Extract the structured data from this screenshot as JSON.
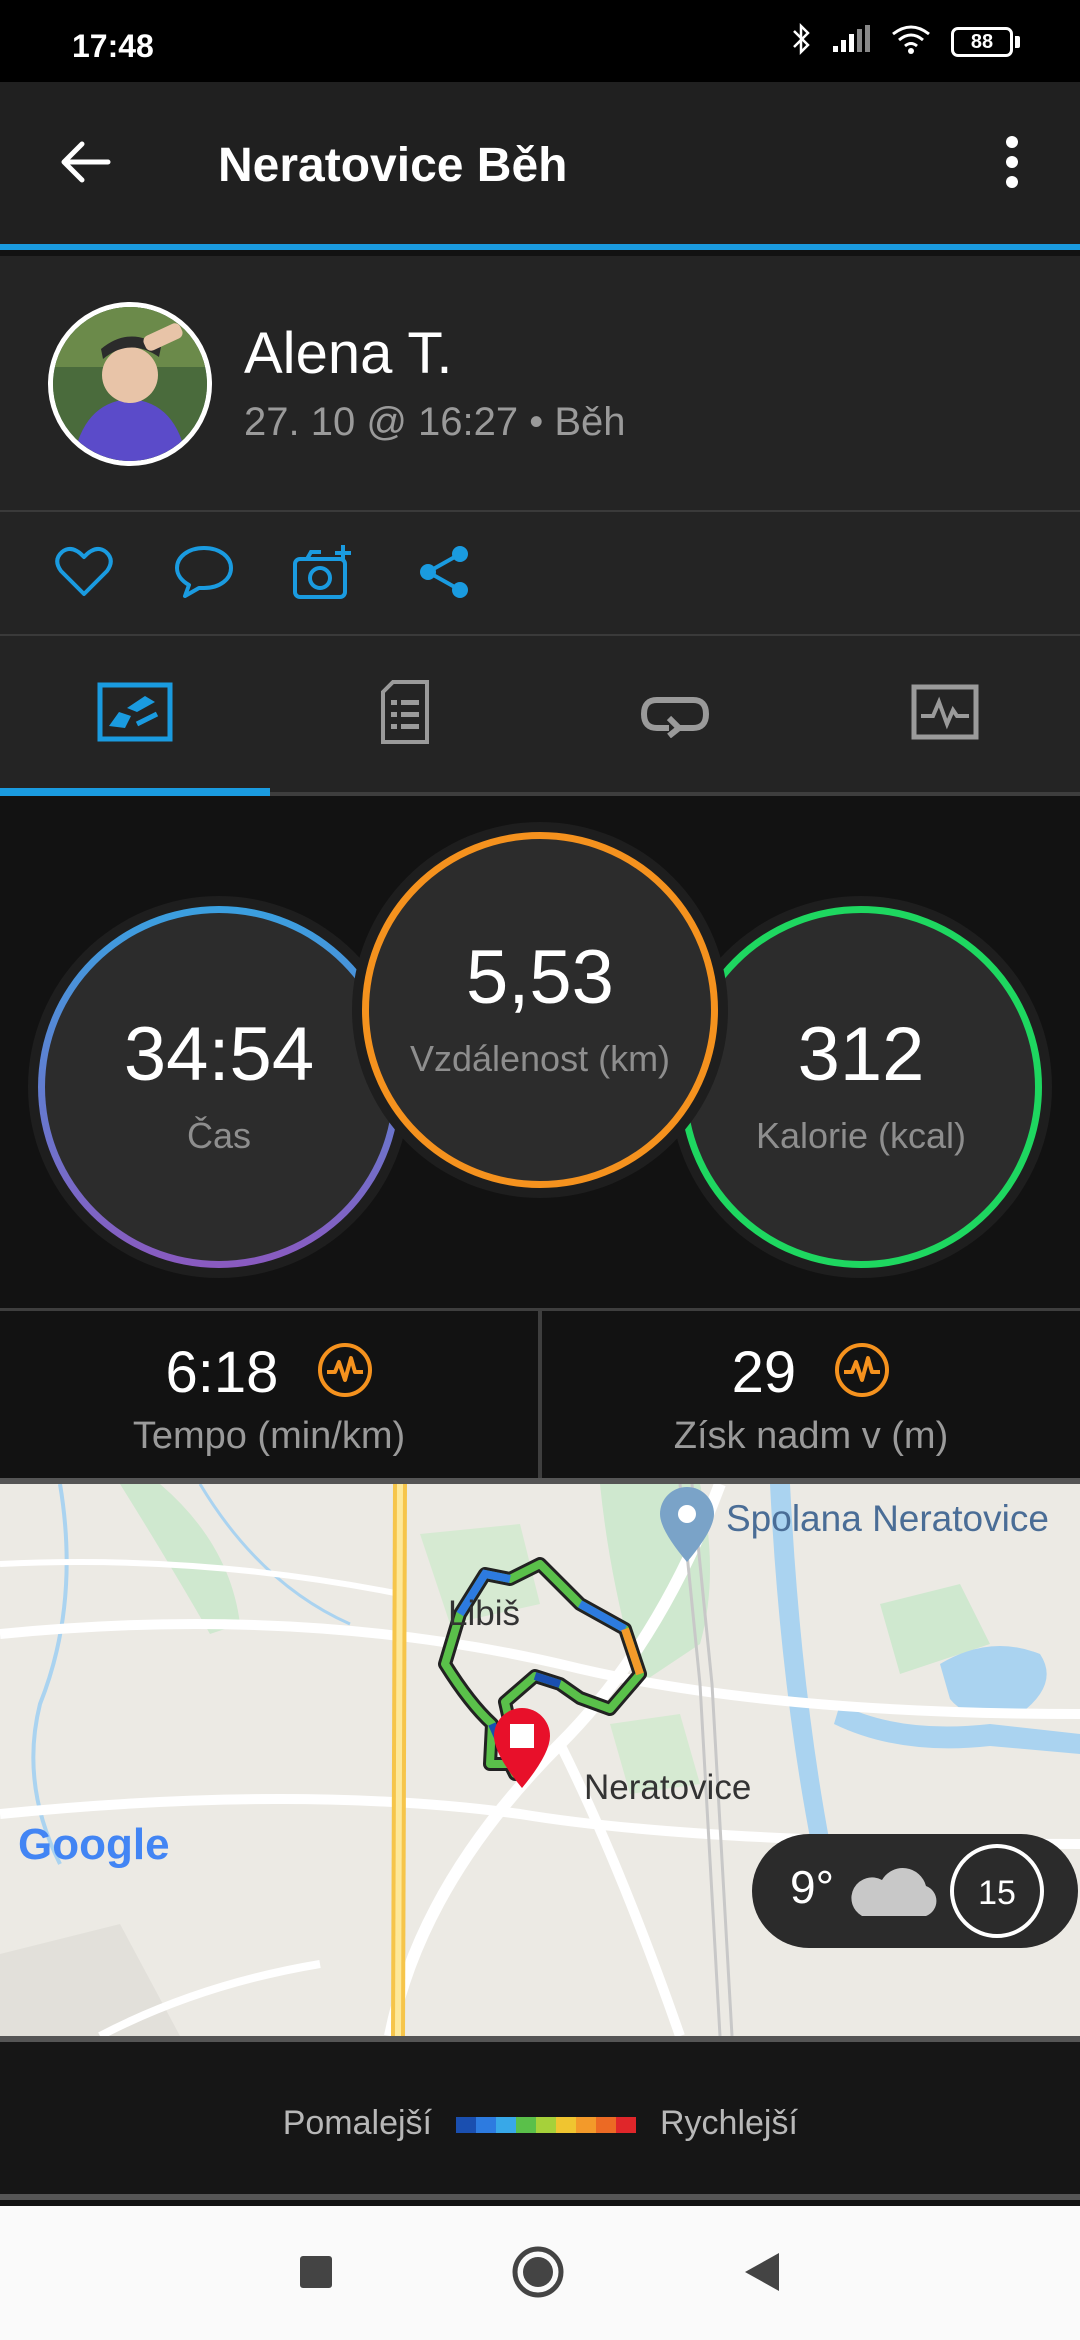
{
  "status_bar": {
    "time": "17:48",
    "battery": "88"
  },
  "header": {
    "title": "Neratovice Běh"
  },
  "user": {
    "name": "Alena T.",
    "meta": "27. 10 @ 16:27 • Běh"
  },
  "colors": {
    "accent": "#1a9be0",
    "time_ring": "#4a8fe0",
    "distance_ring": "#f5921e",
    "calories_ring": "#1ed760",
    "hr_badge": "#f5921e"
  },
  "actions": [
    {
      "icon": "heart-icon"
    },
    {
      "icon": "comment-icon"
    },
    {
      "icon": "add-photo-icon"
    },
    {
      "icon": "share-icon"
    }
  ],
  "tabs": [
    {
      "icon": "summary-map-icon",
      "selected": true
    },
    {
      "icon": "details-document-icon",
      "selected": false
    },
    {
      "icon": "laps-icon",
      "selected": false
    },
    {
      "icon": "charts-icon",
      "selected": false
    }
  ],
  "stats": {
    "time": {
      "value": "34:54",
      "label": "Čas"
    },
    "distance": {
      "value": "5,53",
      "label": "Vzdálenost (km)"
    },
    "calories": {
      "value": "312",
      "label": "Kalorie (kcal)"
    }
  },
  "metrics": {
    "pace": {
      "value": "6:18",
      "label": "Tempo (min/km)"
    },
    "elevation": {
      "value": "29",
      "label": "Získ nadm v (m)"
    }
  },
  "map": {
    "place_poi": "Spolana Neratovice",
    "place_libis": "Libiš",
    "place_town": "Neratovice",
    "google": "Google",
    "weather": {
      "temp": "9°",
      "wind": "15"
    }
  },
  "legend": {
    "slower": "Pomalejší",
    "faster": "Rychlejší",
    "gradient": [
      "#1a4fb0",
      "#2d7be0",
      "#38a8e8",
      "#5ac04a",
      "#a6d13a",
      "#f0c530",
      "#f39a2a",
      "#ec6a24",
      "#e0262a"
    ]
  }
}
